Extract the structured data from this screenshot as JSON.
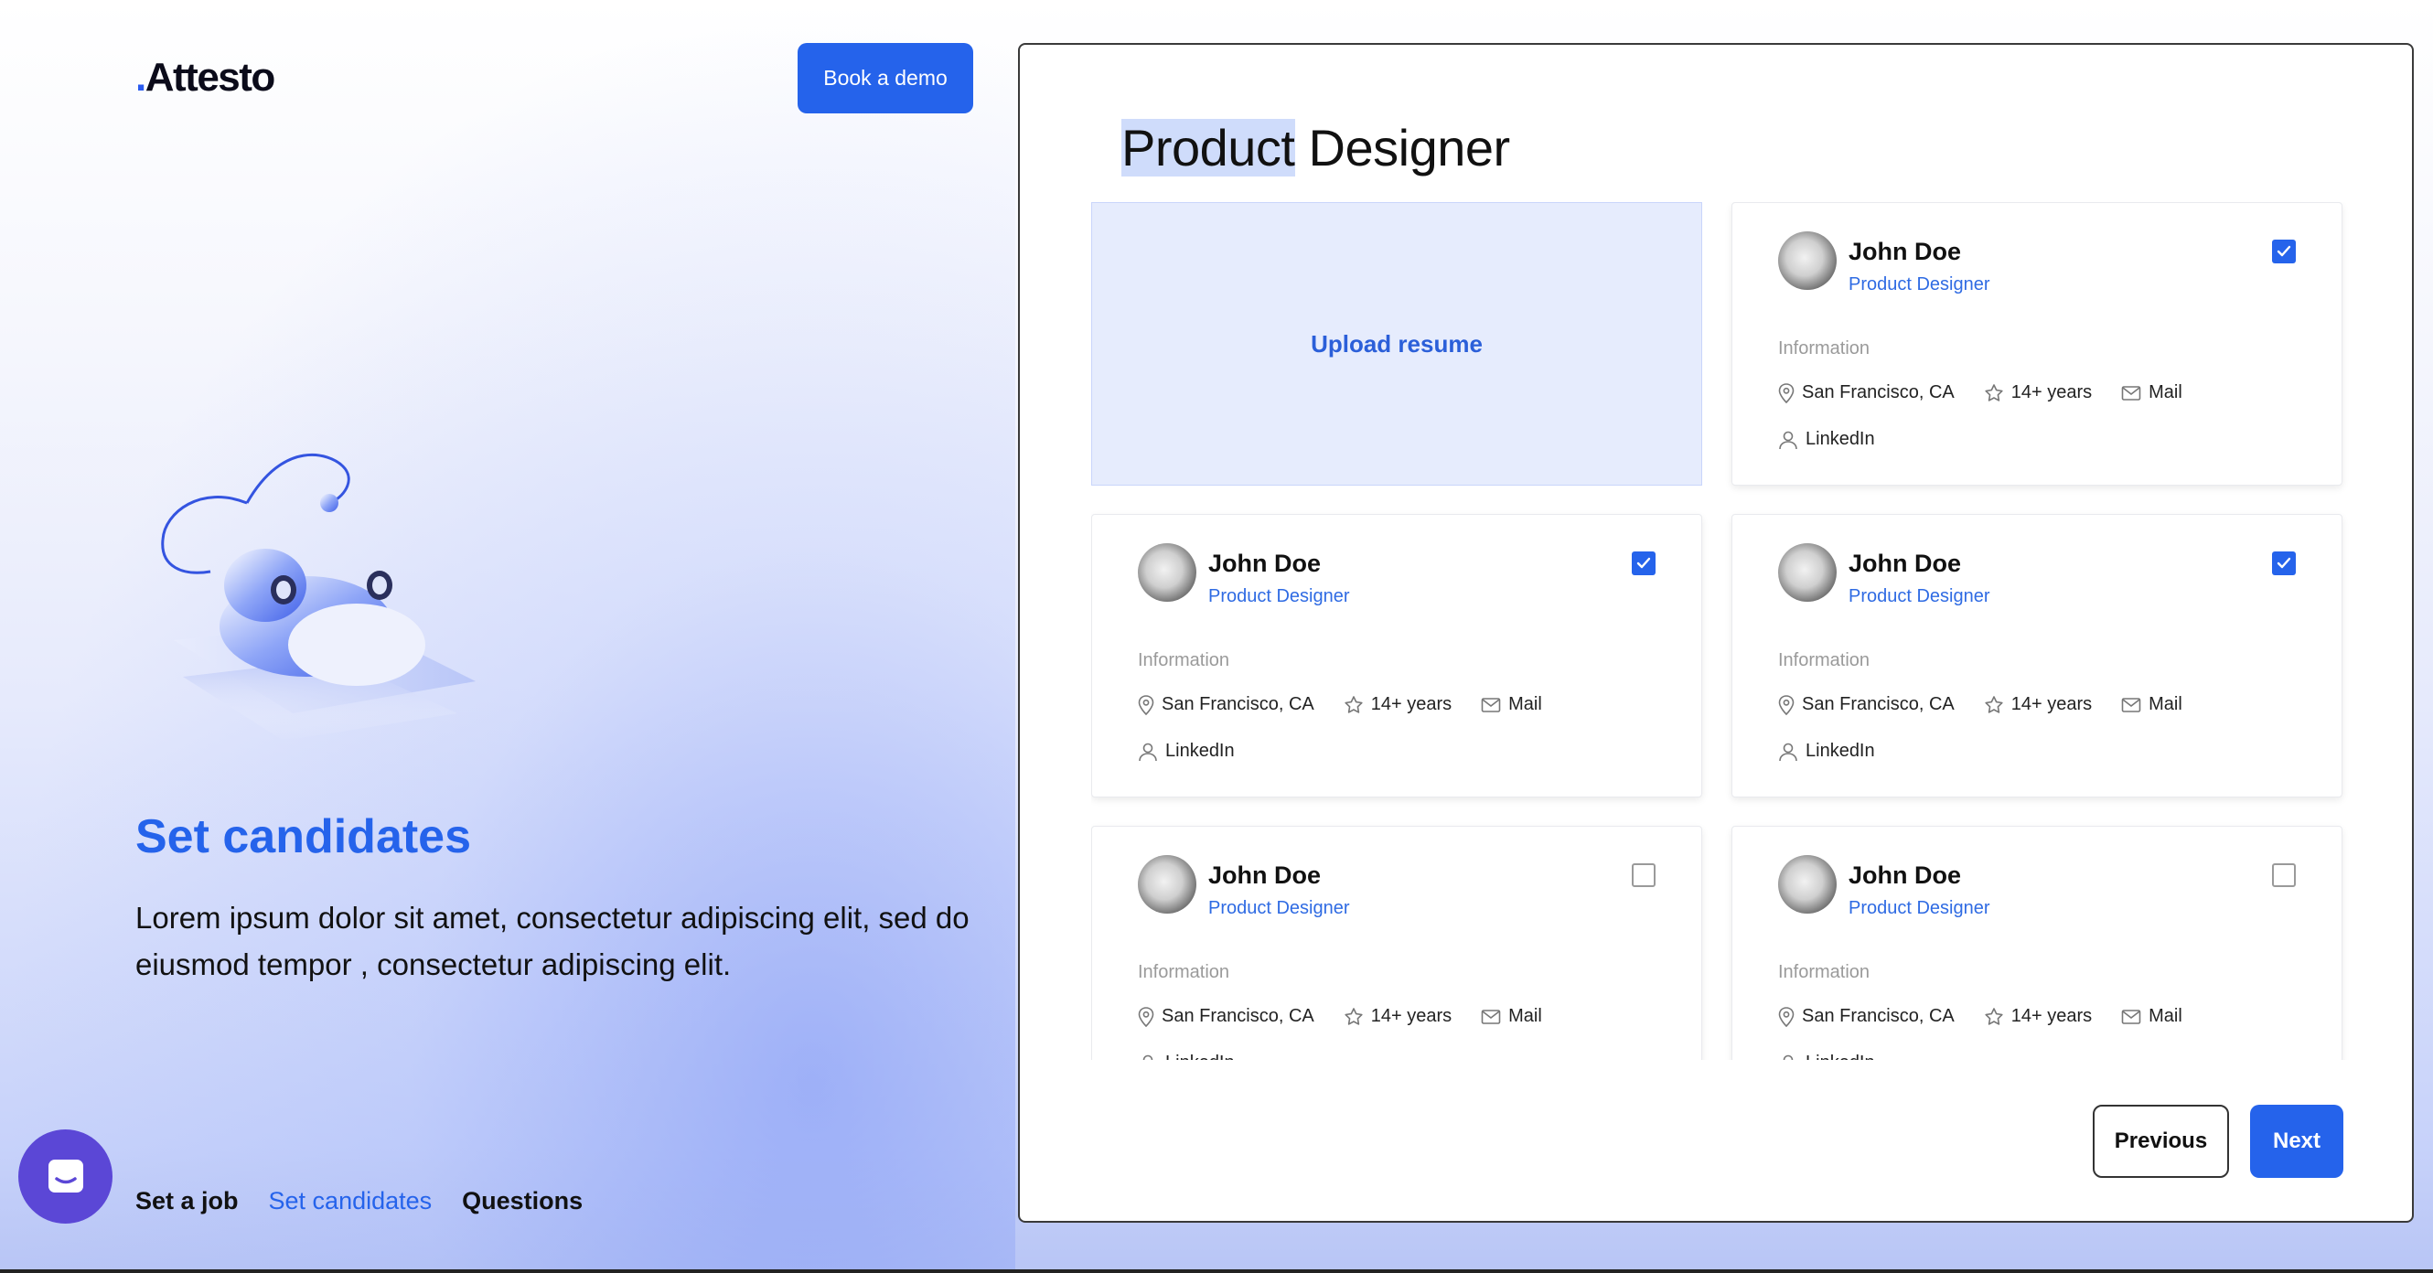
{
  "brand": {
    "dot": ".",
    "name": "Attesto",
    "accent": "#2563eb"
  },
  "header": {
    "demo_label": "Book a demo"
  },
  "hero": {
    "title": "Set candidates",
    "description": "Lorem ipsum dolor sit amet, consectetur adipiscing elit, sed do eiusmod tempor , consectetur adipiscing elit."
  },
  "steps": [
    {
      "label": "Set a job",
      "active": false
    },
    {
      "label": "Set candidates",
      "active": true
    },
    {
      "label": "Questions",
      "active": false
    }
  ],
  "panel": {
    "title_highlight": "Product",
    "title_rest": " Designer",
    "upload_label": "Upload resume"
  },
  "card_labels": {
    "info": "Information",
    "location": "San Francisco, CA",
    "experience": "14+ years",
    "mail": "Mail",
    "linkedin": "LinkedIn"
  },
  "candidates": [
    {
      "name": "John Doe",
      "role": "Product Designer",
      "checked": true
    },
    {
      "name": "John Doe",
      "role": "Product Designer",
      "checked": true
    },
    {
      "name": "John Doe",
      "role": "Product Designer",
      "checked": true
    },
    {
      "name": "John Doe",
      "role": "Product Designer",
      "checked": false
    },
    {
      "name": "John Doe",
      "role": "Product Designer",
      "checked": false
    }
  ],
  "nav": {
    "previous": "Previous",
    "next": "Next"
  }
}
